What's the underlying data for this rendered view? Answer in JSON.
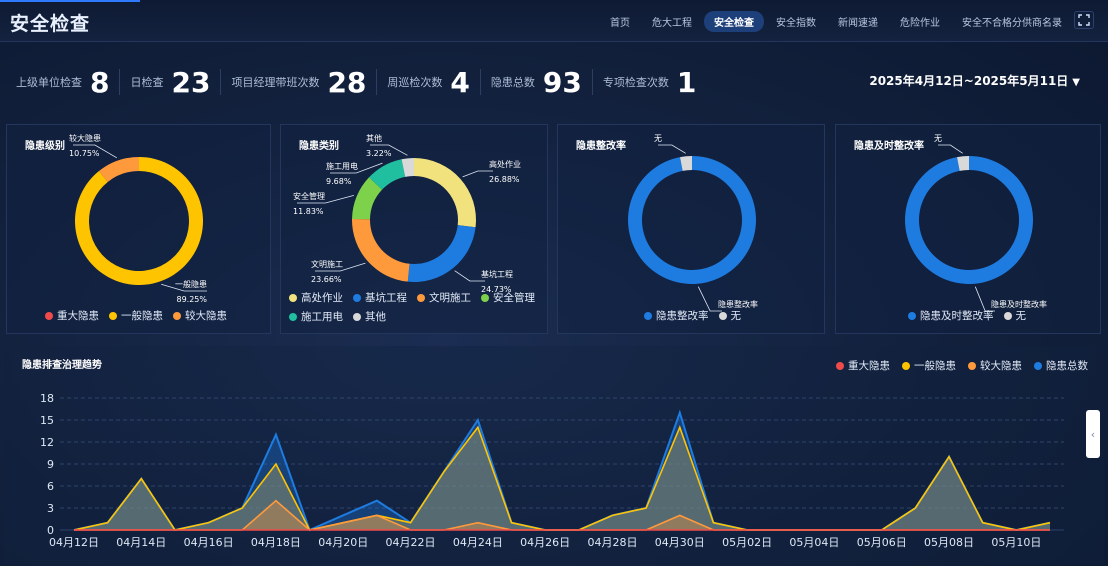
{
  "header": {
    "title": "安全检查",
    "nav": [
      "首页",
      "危大工程",
      "安全检查",
      "安全指数",
      "新闻速递",
      "危险作业",
      "安全不合格分供商名录"
    ],
    "active_nav": 2,
    "fullscreen_icon": "fullscreen-icon"
  },
  "stats": [
    {
      "label": "上级单位检查",
      "value": "8"
    },
    {
      "label": "日检查",
      "value": "23"
    },
    {
      "label": "项目经理带班次数",
      "value": "28"
    },
    {
      "label": "周巡检次数",
      "value": "4"
    },
    {
      "label": "隐患总数",
      "value": "93"
    },
    {
      "label": "专项检查次数",
      "value": "1"
    }
  ],
  "date_range": "2025年4月12日~2025年5月11日",
  "colors": {
    "red": "#f04a4a",
    "yellow": "#ffc400",
    "orange": "#ff9a3c",
    "blue": "#1e7be0",
    "light_yellow": "#f2e27e",
    "green": "#7ed14a",
    "teal": "#1fbf9f",
    "grey": "#d9d9d9"
  },
  "chart_data": [
    {
      "type": "pie",
      "title": "隐患级别",
      "labels": [
        "重大隐患",
        "一般隐患",
        "较大隐患"
      ],
      "values": [
        0,
        89.25,
        10.75
      ],
      "callouts": [
        {
          "name": "较大隐患",
          "pct": "10.75%"
        },
        {
          "name": "一般隐患",
          "pct": "89.25%"
        }
      ]
    },
    {
      "type": "pie",
      "title": "隐患类别",
      "labels": [
        "高处作业",
        "基坑工程",
        "文明施工",
        "安全管理",
        "施工用电",
        "其他"
      ],
      "values": [
        26.88,
        24.73,
        23.66,
        11.83,
        9.68,
        3.22
      ],
      "callouts": [
        {
          "name": "高处作业",
          "pct": "26.88%"
        },
        {
          "name": "基坑工程",
          "pct": "24.73%"
        },
        {
          "name": "文明施工",
          "pct": "23.66%"
        },
        {
          "name": "安全管理",
          "pct": "11.83%"
        },
        {
          "name": "施工用电",
          "pct": "9.68%"
        },
        {
          "name": "其他",
          "pct": "3.22%"
        }
      ]
    },
    {
      "type": "pie",
      "title": "隐患整改率",
      "labels": [
        "隐患整改率",
        "无"
      ],
      "values": [
        97,
        3
      ],
      "callouts": [
        {
          "name": "无"
        },
        {
          "name": "隐患整改率"
        }
      ]
    },
    {
      "type": "pie",
      "title": "隐患及时整改率",
      "labels": [
        "隐患及时整改率",
        "无"
      ],
      "values": [
        97,
        3
      ],
      "callouts": [
        {
          "name": "无"
        },
        {
          "name": "隐患及时整改率"
        }
      ]
    },
    {
      "type": "area",
      "title": "隐患排查治理趋势",
      "x": [
        "04月12日",
        "04月13日",
        "04月14日",
        "04月15日",
        "04月16日",
        "04月17日",
        "04月18日",
        "04月19日",
        "04月20日",
        "04月21日",
        "04月22日",
        "04月23日",
        "04月24日",
        "04月25日",
        "04月26日",
        "04月27日",
        "04月28日",
        "04月29日",
        "04月30日",
        "05月01日",
        "05月02日",
        "05月03日",
        "05月04日",
        "05月05日",
        "05月06日",
        "05月07日",
        "05月08日",
        "05月09日",
        "05月10日",
        "05月11日"
      ],
      "x_tick_labels": [
        "04月12日",
        "04月14日",
        "04月16日",
        "04月18日",
        "04月20日",
        "04月22日",
        "04月24日",
        "04月26日",
        "04月28日",
        "04月30日",
        "05月02日",
        "05月04日",
        "05月06日",
        "05月08日",
        "05月10日"
      ],
      "ylim": [
        0,
        18
      ],
      "yticks": [
        0,
        3,
        6,
        9,
        12,
        15,
        18
      ],
      "series": [
        {
          "name": "重大隐患",
          "color": "#f04a4a",
          "values": [
            0,
            0,
            0,
            0,
            0,
            0,
            0,
            0,
            0,
            0,
            0,
            0,
            0,
            0,
            0,
            0,
            0,
            0,
            0,
            0,
            0,
            0,
            0,
            0,
            0,
            0,
            0,
            0,
            0,
            0
          ]
        },
        {
          "name": "一般隐患",
          "color": "#ffc400",
          "values": [
            0,
            1,
            7,
            0,
            1,
            3,
            9,
            0,
            1,
            2,
            1,
            8,
            14,
            1,
            0,
            0,
            2,
            3,
            14,
            1,
            0,
            0,
            0,
            0,
            0,
            3,
            10,
            1,
            0,
            1
          ]
        },
        {
          "name": "较大隐患",
          "color": "#ff9a3c",
          "values": [
            0,
            0,
            0,
            0,
            0,
            0,
            4,
            0,
            1,
            2,
            0,
            0,
            1,
            0,
            0,
            0,
            0,
            0,
            2,
            0,
            0,
            0,
            0,
            0,
            0,
            0,
            0,
            0,
            0,
            0
          ]
        },
        {
          "name": "隐患总数",
          "color": "#1e7be0",
          "values": [
            0,
            1,
            7,
            0,
            1,
            3,
            13,
            0,
            2,
            4,
            1,
            8,
            15,
            1,
            0,
            0,
            2,
            3,
            16,
            1,
            0,
            0,
            0,
            0,
            0,
            3,
            10,
            1,
            0,
            1
          ]
        }
      ]
    }
  ]
}
